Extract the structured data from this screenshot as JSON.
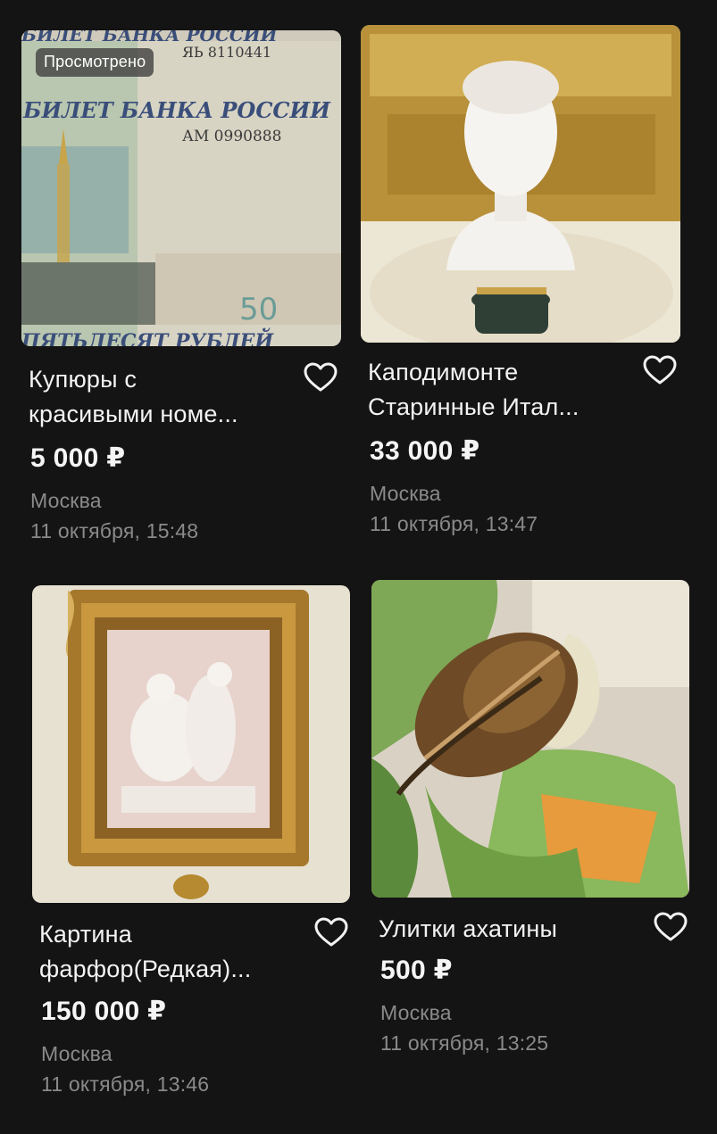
{
  "listings": [
    {
      "badge": "Просмотрено",
      "title": "Купюры с\nкрасивыми номе...",
      "price": "5 000 ₽",
      "city": "Москва",
      "date": "11 октября, 15:48",
      "favorite_icon": "heart-outline-icon"
    },
    {
      "title": "Каподимонте\nСтаринные Итал...",
      "price": "33 000 ₽",
      "city": "Москва",
      "date": "11 октября, 13:47",
      "favorite_icon": "heart-outline-icon"
    },
    {
      "title": "Картина\nфарфор(Редкая)...",
      "price": "150 000 ₽",
      "city": "Москва",
      "date": "11 октября, 13:46",
      "favorite_icon": "heart-outline-icon"
    },
    {
      "title": "Улитки ахатины",
      "price": "500 ₽",
      "city": "Москва",
      "date": "11 октября, 13:25",
      "favorite_icon": "heart-outline-icon"
    }
  ],
  "photo_text": {
    "banknote_line1": "БИЛЕТ БАНКА РОССИИ",
    "banknote_serial1": "ЯЬ 8110441",
    "banknote_line2": "БИЛЕТ БАНКА РОССИИ",
    "banknote_serial2": "АМ 0990888",
    "banknote_denomination": "50",
    "banknote_bottom": "ПЯТЬДЕСЯТ РУБЛЕЙ"
  },
  "colors": {
    "background": "#141414",
    "text_primary": "#f3f3f3",
    "text_secondary": "#8a8a8a",
    "badge_bg": "#3c3c3c"
  }
}
